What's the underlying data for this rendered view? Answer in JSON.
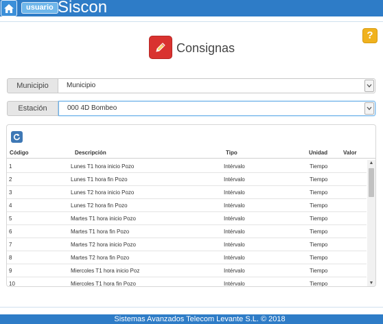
{
  "header": {
    "user_badge": "usuario",
    "app_title": "Siscon",
    "icons": {
      "home": "home-icon",
      "help": "help-icon"
    }
  },
  "help": {
    "label": "?"
  },
  "page": {
    "title": "Consignas",
    "icon": "pencil-icon"
  },
  "form": {
    "municipio": {
      "label": "Municipio",
      "value": "Municipio"
    },
    "estacion": {
      "label": "Estación",
      "value": "000 4D Bombeo"
    }
  },
  "table": {
    "columns": {
      "codigo": "Código",
      "descripcion": "Descripción",
      "tipo": "Tipo",
      "unidad": "Unidad",
      "valor": "Valor"
    },
    "rows": [
      {
        "codigo": "1",
        "descripcion": "Lunes T1 hora inicio Pozo",
        "tipo": "Intérvalo",
        "unidad": "Tiempo",
        "valor": ""
      },
      {
        "codigo": "2",
        "descripcion": "Lunes T1 hora fin Pozo",
        "tipo": "Intérvalo",
        "unidad": "Tiempo",
        "valor": ""
      },
      {
        "codigo": "3",
        "descripcion": "Lunes T2 hora inicio Pozo",
        "tipo": "Intérvalo",
        "unidad": "Tiempo",
        "valor": ""
      },
      {
        "codigo": "4",
        "descripcion": "Lunes T2 hora fin Pozo",
        "tipo": "Intérvalo",
        "unidad": "Tiempo",
        "valor": ""
      },
      {
        "codigo": "5",
        "descripcion": "Martes T1 hora inicio Pozo",
        "tipo": "Intérvalo",
        "unidad": "Tiempo",
        "valor": ""
      },
      {
        "codigo": "6",
        "descripcion": "Martes T1 hora fin Pozo",
        "tipo": "Intérvalo",
        "unidad": "Tiempo",
        "valor": ""
      },
      {
        "codigo": "7",
        "descripcion": "Martes T2 hora inicio Pozo",
        "tipo": "Intérvalo",
        "unidad": "Tiempo",
        "valor": ""
      },
      {
        "codigo": "8",
        "descripcion": "Martes T2 hora fin Pozo",
        "tipo": "Intérvalo",
        "unidad": "Tiempo",
        "valor": ""
      },
      {
        "codigo": "9",
        "descripcion": "Miercoles T1 hora inicio Poz",
        "tipo": "Intérvalo",
        "unidad": "Tiempo",
        "valor": ""
      },
      {
        "codigo": "10",
        "descripcion": "Miercoles T1 hora fin Pozo",
        "tipo": "Intérvalo",
        "unidad": "Tiempo",
        "valor": ""
      }
    ]
  },
  "footer": {
    "text": "Sistemas Avanzados Telecom Levante S.L. © 2018"
  },
  "colors": {
    "header_blue": "#2e7cc7",
    "help_yellow": "#f0b21e",
    "page_icon_red": "#d9322f",
    "refresh_blue": "#3e78b5"
  }
}
